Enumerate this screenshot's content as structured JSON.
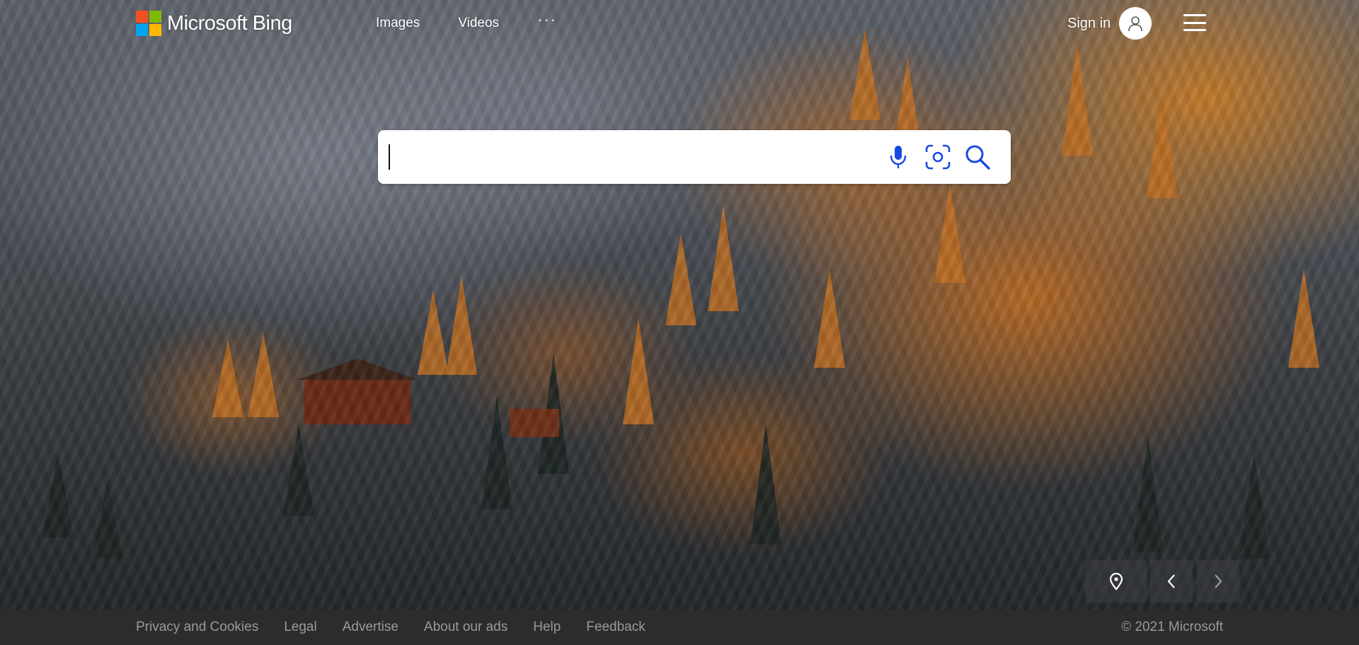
{
  "brand": {
    "name": "Microsoft Bing",
    "colors": {
      "red": "#f25022",
      "green": "#7fba00",
      "blue": "#00a4ef",
      "yellow": "#ffb900"
    }
  },
  "nav": {
    "items": [
      {
        "label": "Images"
      },
      {
        "label": "Videos"
      }
    ],
    "more_label": "···"
  },
  "account": {
    "signin_label": "Sign in",
    "avatar_icon": "user-icon"
  },
  "menu": {
    "icon": "hamburger-menu-icon"
  },
  "search": {
    "value": "",
    "placeholder": "",
    "icons": [
      "microphone-icon",
      "visual-search-icon",
      "search-icon"
    ],
    "accent": "#174ae4"
  },
  "image_controls": {
    "icons": [
      "location-pin-icon",
      "chevron-left-icon",
      "chevron-right-icon"
    ]
  },
  "footer": {
    "links": [
      {
        "label": "Privacy and Cookies"
      },
      {
        "label": "Legal"
      },
      {
        "label": "Advertise"
      },
      {
        "label": "About our ads"
      },
      {
        "label": "Help"
      },
      {
        "label": "Feedback"
      }
    ],
    "copyright": "© 2021 Microsoft"
  }
}
